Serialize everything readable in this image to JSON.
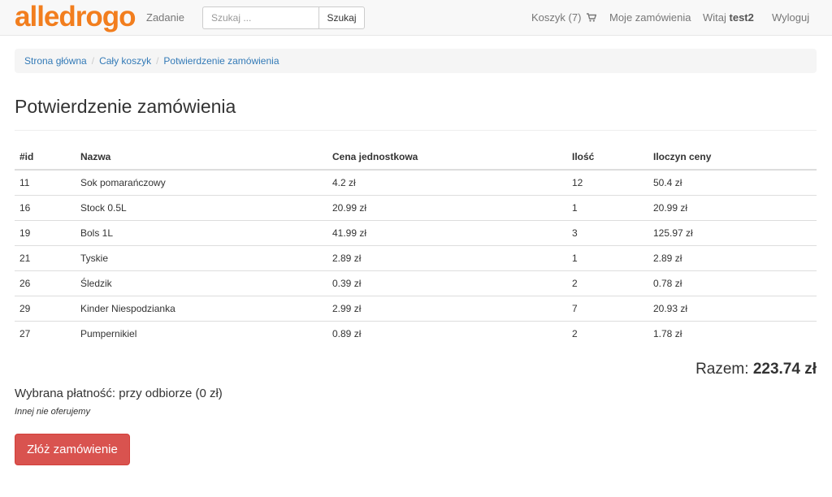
{
  "navbar": {
    "brand": "alledrogo",
    "task_link": "Zadanie",
    "search_placeholder": "Szukaj ...",
    "search_button": "Szukaj",
    "cart_link": "Koszyk (7)",
    "cart_icon": "shopping-cart-icon",
    "orders_link": "Moje zamówienia",
    "greeting_prefix": "Witaj",
    "username": "test2",
    "logout_link": "Wyloguj"
  },
  "breadcrumb": {
    "items": [
      "Strona główna",
      "Cały koszyk",
      "Potwierdzenie zamówienia"
    ],
    "separator": "/"
  },
  "page": {
    "title": "Potwierdzenie zamówienia"
  },
  "table": {
    "headers": [
      "#id",
      "Nazwa",
      "Cena jednostkowa",
      "Ilość",
      "Iloczyn ceny"
    ],
    "rows": [
      [
        "11",
        "Sok pomarańczowy",
        "4.2 zł",
        "12",
        "50.4 zł"
      ],
      [
        "16",
        "Stock 0.5L",
        "20.99 zł",
        "1",
        "20.99 zł"
      ],
      [
        "19",
        "Bols 1L",
        "41.99 zł",
        "3",
        "125.97 zł"
      ],
      [
        "21",
        "Tyskie",
        "2.89 zł",
        "1",
        "2.89 zł"
      ],
      [
        "26",
        "Śledzik",
        "0.39 zł",
        "2",
        "0.78 zł"
      ],
      [
        "29",
        "Kinder Niespodzianka",
        "2.99 zł",
        "7",
        "20.93 zł"
      ],
      [
        "27",
        "Pumpernikiel",
        "0.89 zł",
        "2",
        "1.78 zł"
      ]
    ]
  },
  "summary": {
    "total_label": "Razem:",
    "total_value": "223.74 zł",
    "payment": "Wybrana płatność: przy odbiorze (0 zł)",
    "note": "Innej nie oferujemy",
    "submit_button": "Złóż zamówienie"
  },
  "colors": {
    "brand": "#f27e1e",
    "link": "#337ab7",
    "danger": "#d9534f"
  }
}
